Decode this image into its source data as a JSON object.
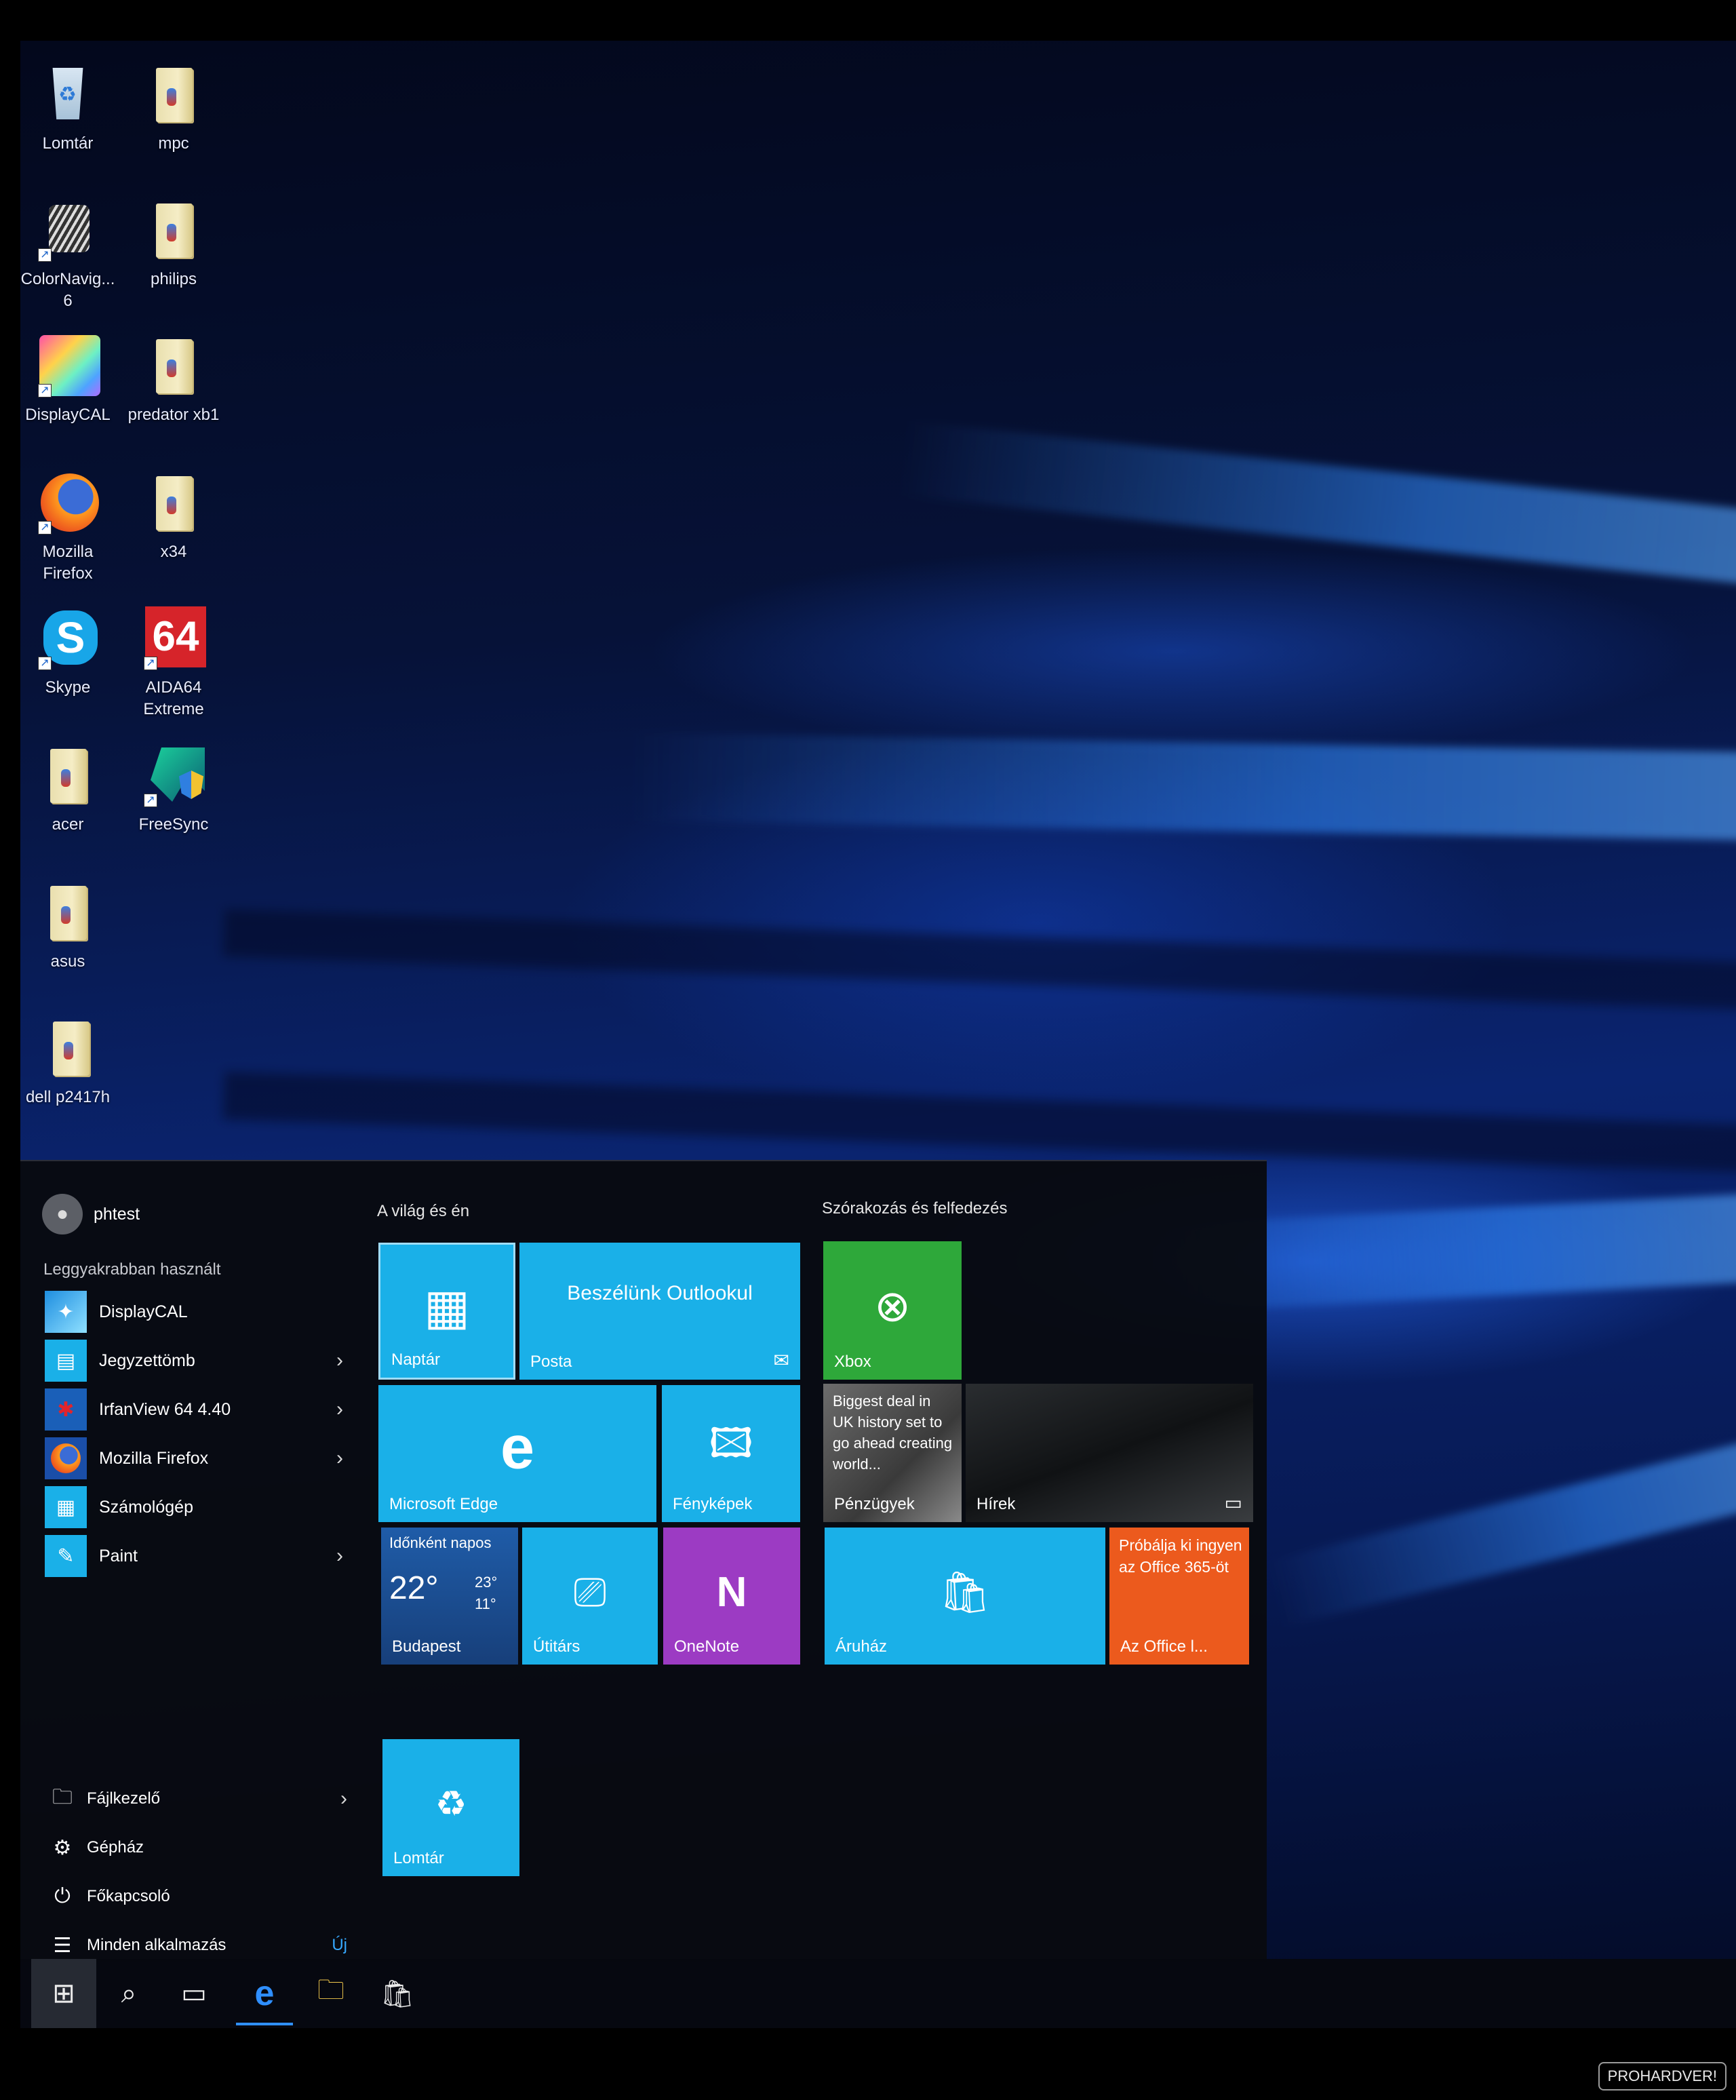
{
  "desktop": {
    "icons": [
      {
        "label": "Lomtár",
        "icon": "recycle-bin-icon"
      },
      {
        "label": "mpc",
        "icon": "folder-icon"
      },
      {
        "label": "ColorNavig...\n6",
        "icon": "colornavigator-icon"
      },
      {
        "label": "philips",
        "icon": "folder-icon"
      },
      {
        "label": "DisplayCAL",
        "icon": "displaycal-icon"
      },
      {
        "label": "predator xb1",
        "icon": "folder-icon"
      },
      {
        "label": "Mozilla\nFirefox",
        "icon": "firefox-icon"
      },
      {
        "label": "x34",
        "icon": "folder-icon"
      },
      {
        "label": "Skype",
        "icon": "skype-icon"
      },
      {
        "label": "AIDA64\nExtreme",
        "icon": "aida64-icon"
      },
      {
        "label": "acer",
        "icon": "folder-icon"
      },
      {
        "label": "FreeSync",
        "icon": "freesync-icon"
      },
      {
        "label": "asus",
        "icon": "folder-icon"
      },
      {
        "label": "dell p2417h",
        "icon": "folder-icon"
      }
    ]
  },
  "start_menu": {
    "user": "phtest",
    "most_used_title": "Leggyakrabban használt",
    "apps": [
      {
        "label": "DisplayCAL",
        "has_submenu": false
      },
      {
        "label": "Jegyzettömb",
        "has_submenu": true
      },
      {
        "label": "IrfanView 64 4.40",
        "has_submenu": true
      },
      {
        "label": "Mozilla Firefox",
        "has_submenu": true
      },
      {
        "label": "Számológép",
        "has_submenu": false
      },
      {
        "label": "Paint",
        "has_submenu": true
      }
    ],
    "system": {
      "file_explorer": "Fájlkezelő",
      "settings": "Gépház",
      "power": "Főkapcsoló",
      "all_apps": "Minden alkalmazás",
      "new_badge": "Új"
    },
    "groups": {
      "life": "A világ és én",
      "play": "Szórakozás és felfedezés"
    },
    "tiles": {
      "calendar": "Naptár",
      "mail_banner": "Beszélünk Outlookul",
      "mail": "Posta",
      "edge": "Microsoft Edge",
      "photos": "Fényképek",
      "weather_title": "Időnként napos",
      "weather_temp": "22°",
      "weather_high": "23°",
      "weather_low": "11°",
      "weather_city": "Budapest",
      "travel": "Útitárs",
      "onenote": "OneNote",
      "xbox": "Xbox",
      "money_headline": "Biggest deal in UK history set to go ahead creating world...",
      "money": "Pénzügyek",
      "news": "Hírek",
      "store": "Áruház",
      "office_promo": "Próbálja ki ingyen az Office 365-öt",
      "office": "Az Office l...",
      "recycle": "Lomtár"
    }
  },
  "colors": {
    "tile_blue": "#1ab0e8",
    "xbox_green": "#2ea83a",
    "onenote_purple": "#9c3bc3",
    "office_orange": "#ec5a1d",
    "weather_blue": "#1f5ca8",
    "accent": "#2f8fff"
  },
  "watermark": "PROHARDVER!"
}
